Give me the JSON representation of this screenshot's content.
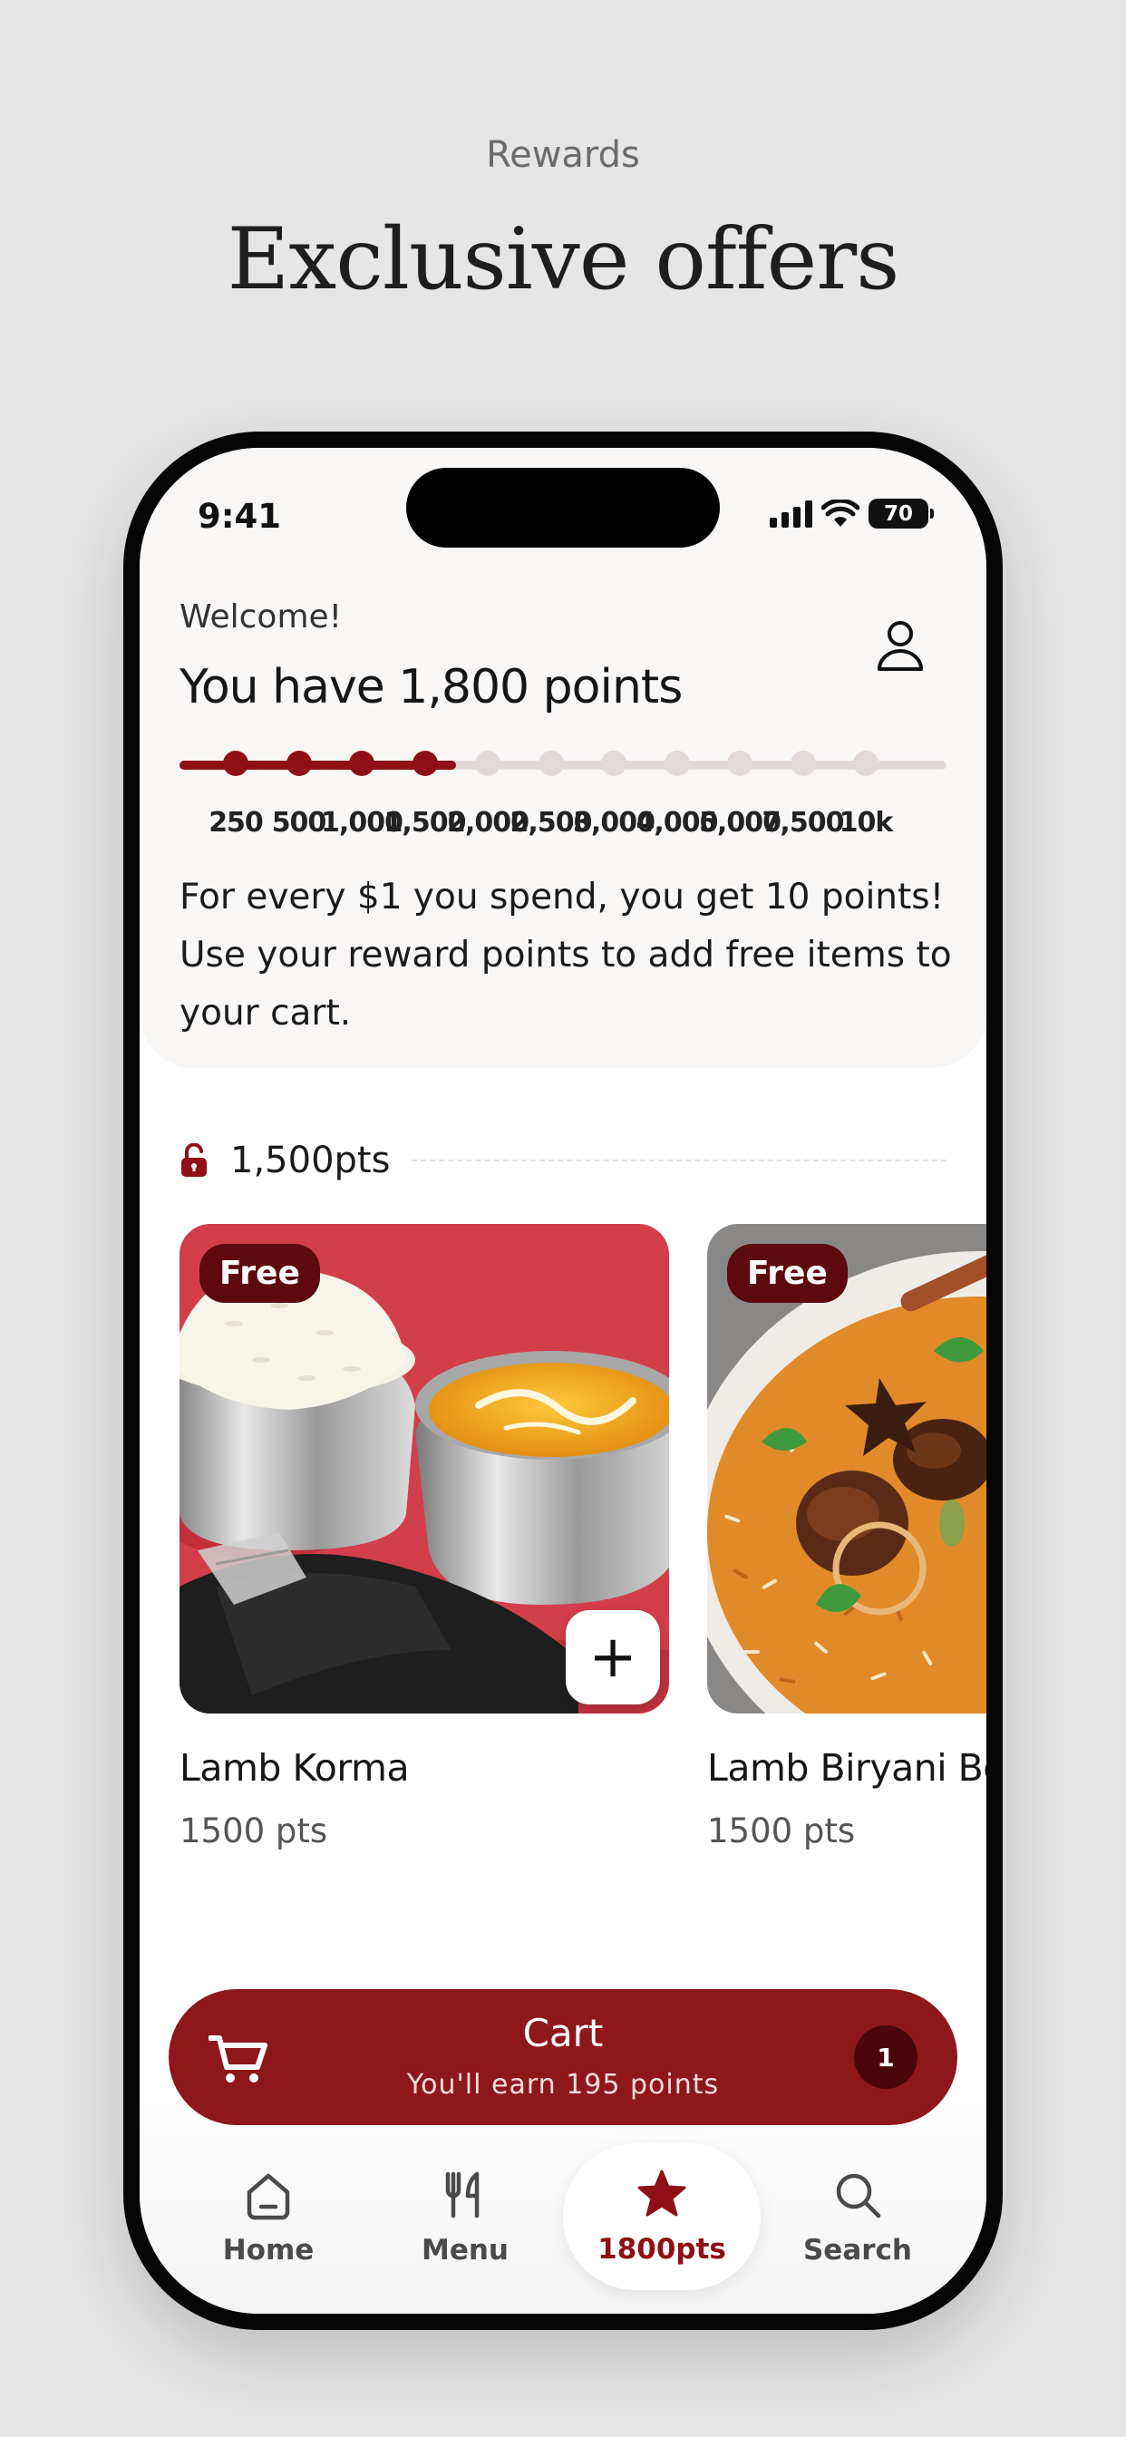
{
  "promo": {
    "eyebrow": "Rewards",
    "headline": "Exclusive offers"
  },
  "status_bar": {
    "time": "9:41",
    "battery": "70"
  },
  "header": {
    "welcome": "Welcome!",
    "points_title": "You have 1,800 points",
    "profile_icon": "person-icon"
  },
  "progress": {
    "current_points": 1800,
    "fill_fraction": 0.36,
    "milestones": [
      {
        "label": "250",
        "reached": true
      },
      {
        "label": "500",
        "reached": true
      },
      {
        "label": "1,000",
        "reached": true
      },
      {
        "label": "1,500",
        "reached": true
      },
      {
        "label": "2,000",
        "reached": false
      },
      {
        "label": "2,500",
        "reached": false
      },
      {
        "label": "3,000",
        "reached": false
      },
      {
        "label": "4,000",
        "reached": false
      },
      {
        "label": "5,000",
        "reached": false
      },
      {
        "label": "7,500",
        "reached": false
      },
      {
        "label": "10k",
        "reached": false
      }
    ]
  },
  "description": "For every $1 you spend, you get 10 points! Use your reward points to add free items to your cart.",
  "tier": {
    "label": "1,500pts",
    "icon": "unlocked-padlock-icon"
  },
  "items": [
    {
      "name": "Lamb Korma",
      "points": "1500 pts",
      "badge": "Free",
      "add_label": "+"
    },
    {
      "name": "Lamb Biryani Bowl",
      "points": "1500 pts",
      "badge": "Free"
    }
  ],
  "cart": {
    "label": "Cart",
    "subtitle": "You'll earn 195 points",
    "count": "1",
    "icon": "cart-icon"
  },
  "tabs": [
    {
      "label": "Home",
      "icon": "home-icon",
      "active": false
    },
    {
      "label": "Menu",
      "icon": "fork-knife-icon",
      "active": false
    },
    {
      "label": "1800pts",
      "icon": "star-icon",
      "active": true
    },
    {
      "label": "Search",
      "icon": "search-icon",
      "active": false
    }
  ],
  "colors": {
    "accent": "#8e1016",
    "cart": "#8e171b",
    "badge": "#5c0a0e",
    "track": "#e2dada"
  }
}
